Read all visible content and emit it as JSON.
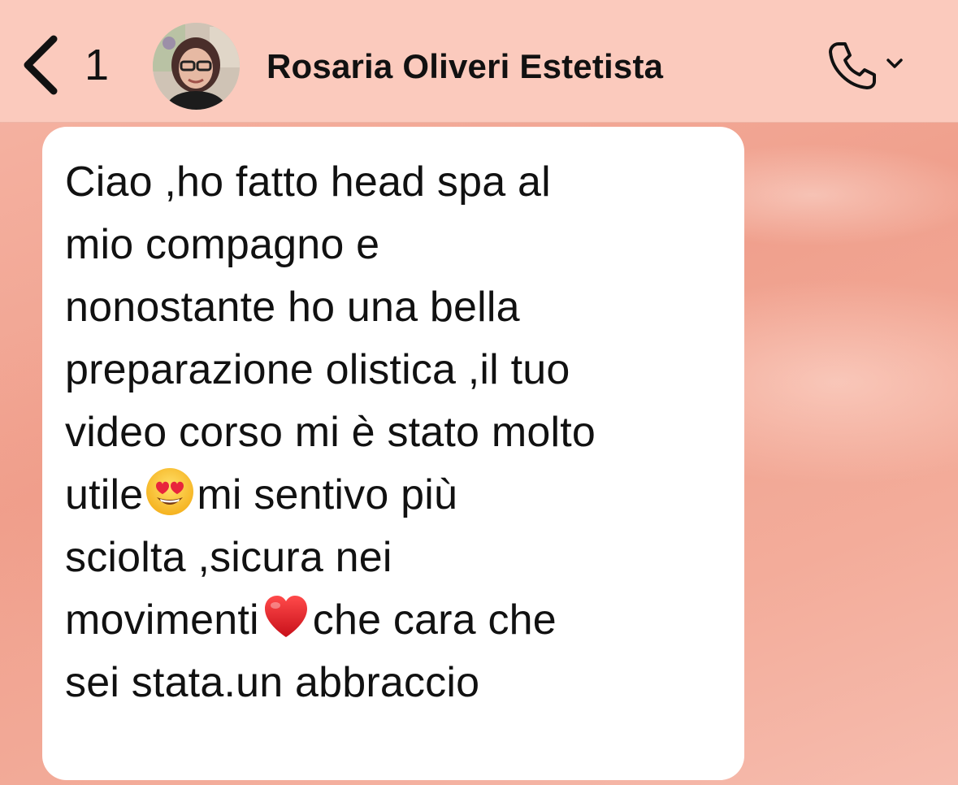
{
  "header": {
    "back_count": "1",
    "contact_name": "Rosaria Oliveri Estetista"
  },
  "icons": {
    "back": "chevron-left-icon",
    "call": "phone-icon",
    "call_menu": "chevron-down-icon",
    "emoji_heart_eyes": "heart-eyes-emoji",
    "emoji_heart": "red-heart-emoji"
  },
  "message": {
    "line1": "Ciao ,ho fatto head spa al",
    "line2": "mio compagno e",
    "line3": "nonostante ho una bella",
    "line4": "preparazione olistica ,il tuo",
    "line5": "video corso mi è stato molto",
    "line6a": "utile",
    "line6b": "mi sentivo più",
    "line7": "sciolta ,sicura nei",
    "line8a": "movimenti",
    "line8b": "che cara che",
    "line9": "sei stata.un abbraccio"
  },
  "colors": {
    "header_bg": "#fbcabd",
    "chat_bg": "#f1a391",
    "bubble_bg": "#ffffff",
    "text": "#111111"
  }
}
